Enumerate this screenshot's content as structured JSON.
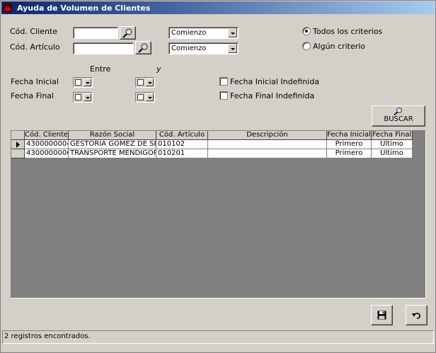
{
  "window": {
    "title": "Ayuda de Volumen de Clientes"
  },
  "filters": {
    "cod_cliente_label": "Cód. Cliente",
    "cod_articulo_label": "Cód. Artículo",
    "cod_cliente_value": "",
    "cod_articulo_value": "",
    "cliente_match": "Comienzo",
    "articulo_match": "Comienzo",
    "entre_label": "Entre",
    "y_label": "y",
    "fecha_inicial_label": "Fecha Inicial",
    "fecha_final_label": "Fecha Final",
    "fecha_inicial_indef_label": "Fecha Inicial Indefinida",
    "fecha_final_indef_label": "Fecha Final Indefinida",
    "todos_label": "Todos los criterios",
    "algun_label": "Algún criterio",
    "selected_criterio": "todos"
  },
  "search_button": {
    "label": "BUSCAR"
  },
  "grid": {
    "headers": [
      "Cód. Cliente",
      "Razón Social",
      "Cód. Artículo",
      "Descripción",
      "Fecha Inicial",
      "Fecha Final"
    ],
    "rows": [
      [
        "4300000004",
        "GESTORIA GOMEZ DE SEG",
        "010102",
        "",
        "Primero",
        "Ultimo"
      ],
      [
        "4300000006",
        "TRANSPORTE MENDIGORI",
        "010201",
        "",
        "Primero",
        "Ultimo"
      ]
    ],
    "selected_row": 0
  },
  "status": {
    "text": "2 registros encontrados."
  },
  "icons": {
    "app": "app-icon",
    "search": "magnifier-icon",
    "save": "floppy-disk-icon",
    "undo": "undo-arrow-icon"
  },
  "colors": {
    "titlebar_start": "#0a246a",
    "titlebar_end": "#a6caf0",
    "face": "#d4d0c8"
  }
}
